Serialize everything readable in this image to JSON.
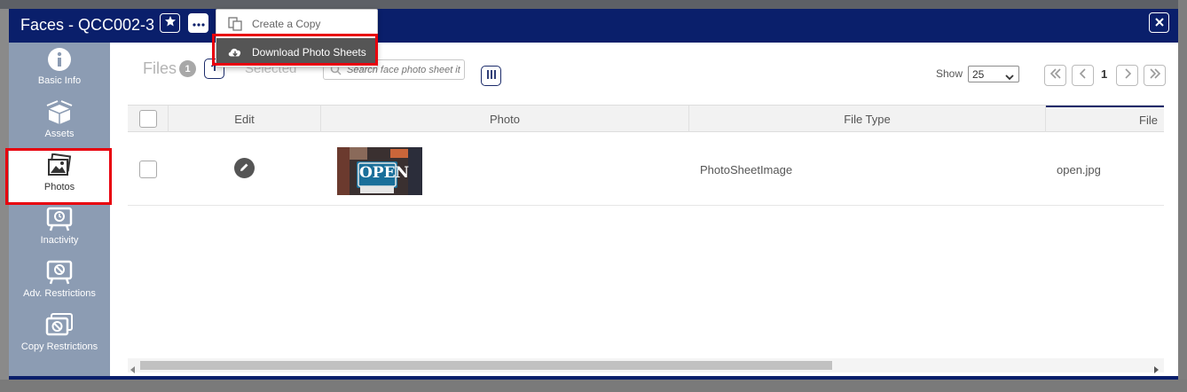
{
  "window": {
    "title": "Faces - QCC002-3"
  },
  "dropdown": {
    "items": [
      {
        "label": "Create a Copy",
        "icon": "copy-icon",
        "active": false
      },
      {
        "label": "Download Photo Sheets",
        "icon": "cloud-download-icon",
        "active": true
      }
    ]
  },
  "sidebar": {
    "items": [
      {
        "label": "Basic Info",
        "icon": "info-icon"
      },
      {
        "label": "Assets",
        "icon": "box-icon"
      },
      {
        "label": "Photos",
        "icon": "photos-icon",
        "active": true
      },
      {
        "label": "Inactivity",
        "icon": "inactivity-icon"
      },
      {
        "label": "Adv. Restrictions",
        "icon": "adv-restriction-icon"
      },
      {
        "label": "Copy Restrictions",
        "icon": "copy-restriction-icon"
      }
    ]
  },
  "toolbar": {
    "files_label": "Files",
    "files_count": "1",
    "selected_label": "Selected",
    "search_placeholder": "Search face photo sheet it",
    "show_label": "Show",
    "show_value": "25",
    "page_number": "1"
  },
  "table": {
    "headers": [
      "Edit",
      "Photo",
      "File Type",
      "File"
    ],
    "rows": [
      {
        "photo_text": "OPEN",
        "file_type": "PhotoSheetImage",
        "file": "open.jpg"
      }
    ]
  },
  "colors": {
    "titlebar": "#0a1f6b",
    "sidebar": "#8c9cb3",
    "highlight": "#e8000d"
  }
}
